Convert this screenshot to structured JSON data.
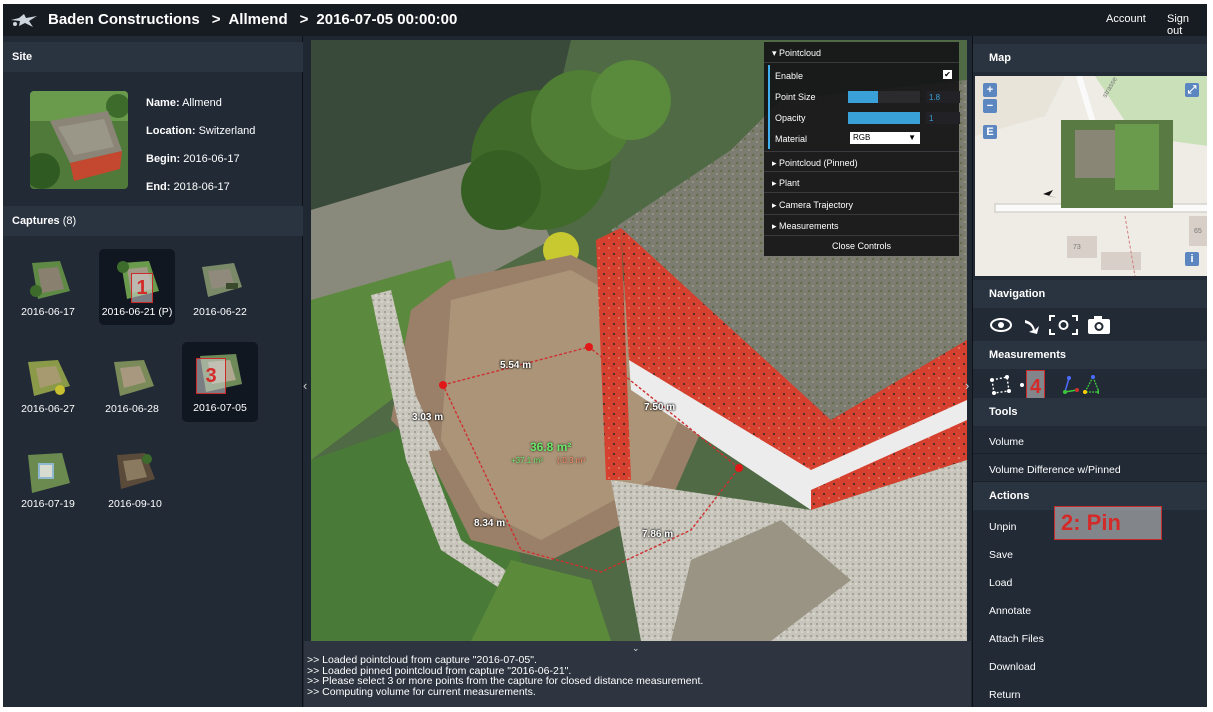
{
  "header": {
    "breadcrumb": [
      "Baden Constructions",
      "Allmend",
      "2016-07-05 00:00:00"
    ],
    "separator": ">",
    "account": "Account",
    "signout": "Sign out"
  },
  "site": {
    "heading": "Site",
    "name_label": "Name:",
    "name": "Allmend",
    "location_label": "Location:",
    "location": "Switzerland",
    "begin_label": "Begin:",
    "begin": "2016-06-17",
    "end_label": "End:",
    "end": "2018-06-17"
  },
  "captures": {
    "heading": "Captures",
    "count": "(8)",
    "items": [
      {
        "label": "2016-06-17"
      },
      {
        "label": "2016-06-21 (P)"
      },
      {
        "label": "2016-06-22"
      },
      {
        "label": "2016-06-27"
      },
      {
        "label": "2016-06-28"
      },
      {
        "label": "2016-07-05"
      },
      {
        "label": "2016-07-19"
      },
      {
        "label": "2016-09-10"
      }
    ]
  },
  "markers": {
    "m1": "1",
    "m2": "2: Pin",
    "m3": "3",
    "m4": "4"
  },
  "controls": {
    "pointcloud": "Pointcloud",
    "enable": "Enable",
    "point_size": "Point Size",
    "point_size_value": "1.8",
    "point_size_fraction": 0.42,
    "opacity": "Opacity",
    "opacity_value": "1",
    "opacity_fraction": 1.0,
    "material": "Material",
    "material_value": "RGB",
    "pinned": "Pointcloud (Pinned)",
    "plant": "Plant",
    "trajectory": "Camera Trajectory",
    "measurements": "Measurements",
    "close": "Close Controls"
  },
  "measurements_3d": {
    "d1": "5.54 m",
    "d2": "3.03 m",
    "d3": "7.50 m",
    "d4": "8.34 m",
    "d5": "7.86 m",
    "area": "36.8 m²",
    "area_plus": "+37.1 m³",
    "area_minus": "(-0.3 m³"
  },
  "console": {
    "lines": [
      ">> Loaded pointcloud from capture \"2016-07-05\".",
      ">> Loaded pinned pointcloud from capture \"2016-06-21\".",
      ">> Please select 3 or more points from the capture for closed distance measurement.",
      ">> Computing volume for current measurements."
    ]
  },
  "right": {
    "map_heading": "Map",
    "map_labels": [
      "strasse",
      "73",
      "65"
    ],
    "navigation_heading": "Navigation",
    "measurements_heading": "Measurements",
    "tools_heading": "Tools",
    "tools": [
      "Volume",
      "Volume Difference w/Pinned"
    ],
    "actions_heading": "Actions",
    "actions": [
      "Unpin",
      "Save",
      "Load",
      "Annotate",
      "Attach Files",
      "Download",
      "Return"
    ]
  },
  "colors": {
    "panel_bg": "#222a36",
    "header_bg": "#2a3340",
    "topbar_bg": "#171c22",
    "accent_blue": "#3aa0d8",
    "marker_red": "#d42a2a",
    "wall_red": "#d6402f"
  }
}
